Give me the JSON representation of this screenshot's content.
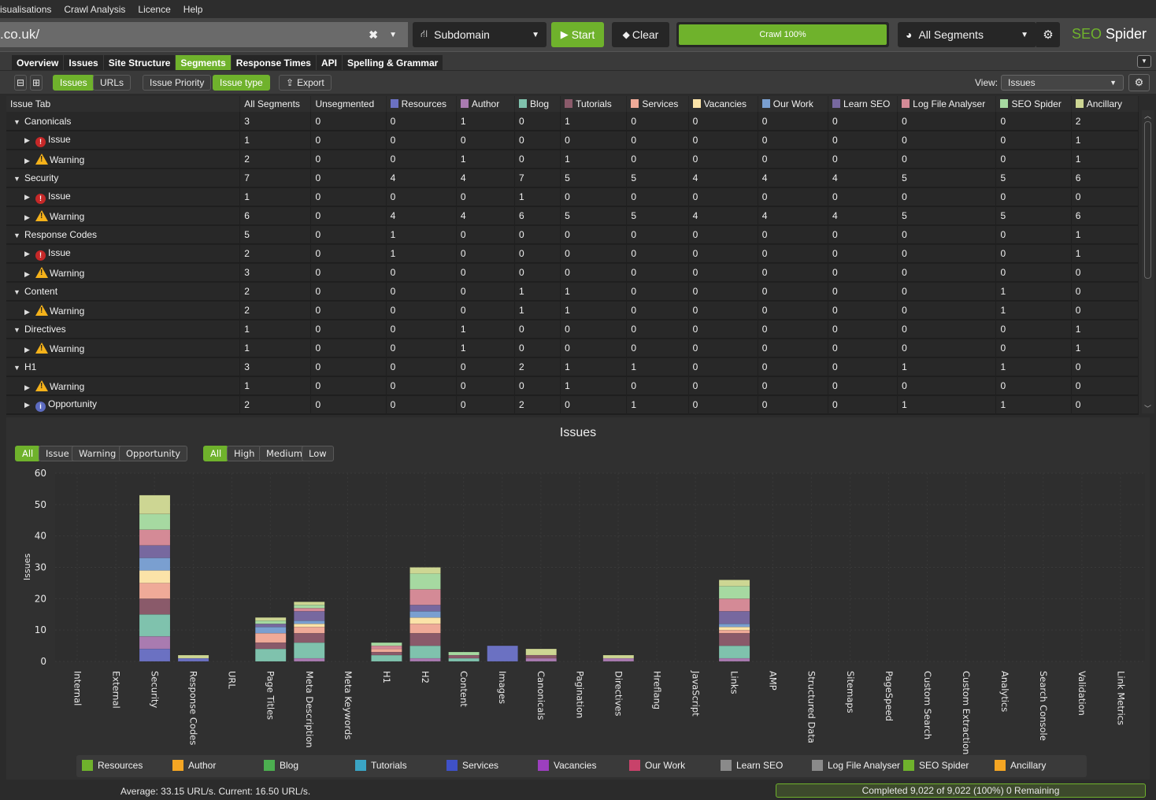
{
  "menu": [
    "isualisations",
    "Crawl Analysis",
    "Licence",
    "Help"
  ],
  "toolbar": {
    "url": ".co.uk/",
    "mode": "Subdomain",
    "start_label": "Start",
    "clear_label": "Clear",
    "crawl_progress_label": "Crawl 100%",
    "crawl_progress": 1.0,
    "segments_label": "All Segments",
    "brand_seo": "SEO",
    "brand_spider": " Spider"
  },
  "tabs": [
    {
      "label": "Overview",
      "active": false
    },
    {
      "label": "Issues",
      "active": false
    },
    {
      "label": "Site Structure",
      "active": false
    },
    {
      "label": "Segments",
      "active": true
    },
    {
      "label": "Response Times",
      "active": false
    },
    {
      "label": "API",
      "active": false
    },
    {
      "label": "Spelling & Grammar",
      "active": false
    }
  ],
  "subtoolbar": {
    "issues_label": "Issues",
    "urls_label": "URLs",
    "issue_priority_label": "Issue Priority",
    "issue_type_label": "Issue type",
    "export_label": "Export",
    "view_label": "View:",
    "view_value": "Issues"
  },
  "segments": [
    {
      "name": "Resources",
      "color": "#6b71c2"
    },
    {
      "name": "Author",
      "color": "#a97bb0"
    },
    {
      "name": "Blog",
      "color": "#7fc2ad"
    },
    {
      "name": "Tutorials",
      "color": "#8a5a6a"
    },
    {
      "name": "Services",
      "color": "#efaa98"
    },
    {
      "name": "Vacancies",
      "color": "#fbe3a8"
    },
    {
      "name": "Our Work",
      "color": "#7a9fd0"
    },
    {
      "name": "Learn SEO",
      "color": "#77689f"
    },
    {
      "name": "Log File Analyser",
      "color": "#d48a96"
    },
    {
      "name": "SEO Spider",
      "color": "#a6d9a1"
    },
    {
      "name": "Ancillary",
      "color": "#cdd693"
    }
  ],
  "table": {
    "headers": [
      "Issue Tab",
      "All Segments",
      "Unsegmented",
      "Resources",
      "Author",
      "Blog",
      "Tutorials",
      "Services",
      "Vacancies",
      "Our Work",
      "Learn SEO",
      "Log File Analyser",
      "SEO Spider",
      "Ancillary"
    ],
    "rows": [
      {
        "level": 0,
        "label": "Canonicals",
        "type": "group",
        "values": [
          3,
          0,
          0,
          1,
          0,
          1,
          0,
          0,
          0,
          0,
          0,
          0,
          2
        ]
      },
      {
        "level": 1,
        "label": "Issue",
        "type": "issue",
        "values": [
          1,
          0,
          0,
          0,
          0,
          0,
          0,
          0,
          0,
          0,
          0,
          0,
          1
        ]
      },
      {
        "level": 1,
        "label": "Warning",
        "type": "warning",
        "values": [
          2,
          0,
          0,
          1,
          0,
          1,
          0,
          0,
          0,
          0,
          0,
          0,
          1
        ]
      },
      {
        "level": 0,
        "label": "Security",
        "type": "group",
        "values": [
          7,
          0,
          4,
          4,
          7,
          5,
          5,
          4,
          4,
          4,
          5,
          5,
          6
        ]
      },
      {
        "level": 1,
        "label": "Issue",
        "type": "issue",
        "values": [
          1,
          0,
          0,
          0,
          1,
          0,
          0,
          0,
          0,
          0,
          0,
          0,
          0
        ]
      },
      {
        "level": 1,
        "label": "Warning",
        "type": "warning",
        "values": [
          6,
          0,
          4,
          4,
          6,
          5,
          5,
          4,
          4,
          4,
          5,
          5,
          6
        ]
      },
      {
        "level": 0,
        "label": "Response Codes",
        "type": "group",
        "values": [
          5,
          0,
          1,
          0,
          0,
          0,
          0,
          0,
          0,
          0,
          0,
          0,
          1
        ]
      },
      {
        "level": 1,
        "label": "Issue",
        "type": "issue",
        "values": [
          2,
          0,
          1,
          0,
          0,
          0,
          0,
          0,
          0,
          0,
          0,
          0,
          1
        ]
      },
      {
        "level": 1,
        "label": "Warning",
        "type": "warning",
        "values": [
          3,
          0,
          0,
          0,
          0,
          0,
          0,
          0,
          0,
          0,
          0,
          0,
          0
        ]
      },
      {
        "level": 0,
        "label": "Content",
        "type": "group",
        "values": [
          2,
          0,
          0,
          0,
          1,
          1,
          0,
          0,
          0,
          0,
          0,
          1,
          0
        ]
      },
      {
        "level": 1,
        "label": "Warning",
        "type": "warning",
        "values": [
          2,
          0,
          0,
          0,
          1,
          1,
          0,
          0,
          0,
          0,
          0,
          1,
          0
        ]
      },
      {
        "level": 0,
        "label": "Directives",
        "type": "group",
        "values": [
          1,
          0,
          0,
          1,
          0,
          0,
          0,
          0,
          0,
          0,
          0,
          0,
          1
        ]
      },
      {
        "level": 1,
        "label": "Warning",
        "type": "warning",
        "values": [
          1,
          0,
          0,
          1,
          0,
          0,
          0,
          0,
          0,
          0,
          0,
          0,
          1
        ]
      },
      {
        "level": 0,
        "label": "H1",
        "type": "group",
        "values": [
          3,
          0,
          0,
          0,
          2,
          1,
          1,
          0,
          0,
          0,
          1,
          1,
          0
        ]
      },
      {
        "level": 1,
        "label": "Warning",
        "type": "warning",
        "values": [
          1,
          0,
          0,
          0,
          0,
          1,
          0,
          0,
          0,
          0,
          0,
          0,
          0
        ]
      },
      {
        "level": 1,
        "label": "Opportunity",
        "type": "opportunity",
        "values": [
          2,
          0,
          0,
          0,
          2,
          0,
          1,
          0,
          0,
          0,
          1,
          1,
          0
        ]
      }
    ]
  },
  "chart_filters": {
    "type_buttons": [
      {
        "label": "All",
        "active": true
      },
      {
        "label": "Issue",
        "active": false
      },
      {
        "label": "Warning",
        "active": false
      },
      {
        "label": "Opportunity",
        "active": false
      }
    ],
    "priority_buttons": [
      {
        "label": "All",
        "active": true
      },
      {
        "label": "High",
        "active": false
      },
      {
        "label": "Medium",
        "active": false
      },
      {
        "label": "Low",
        "active": false
      }
    ]
  },
  "chart_data": {
    "type": "bar",
    "stacked": true,
    "title": "Issues",
    "xlabel": "",
    "ylabel": "Issues",
    "ylim": [
      0,
      60
    ],
    "yticks": [
      0,
      10,
      20,
      30,
      40,
      50,
      60
    ],
    "grid": true,
    "categories": [
      "Internal",
      "External",
      "Security",
      "Response Codes",
      "URL",
      "Page Titles",
      "Meta Description",
      "Meta Keywords",
      "H1",
      "H2",
      "Content",
      "Images",
      "Canonicals",
      "Pagination",
      "Directives",
      "Hreflang",
      "JavaScript",
      "Links",
      "AMP",
      "Structured Data",
      "Sitemaps",
      "PageSpeed",
      "Custom Search",
      "Custom Extraction",
      "Analytics",
      "Search Console",
      "Validation",
      "Link Metrics"
    ],
    "series": [
      {
        "name": "Resources",
        "values": [
          0,
          0,
          4,
          1,
          0,
          0,
          0,
          0,
          0,
          0,
          0,
          5,
          0,
          0,
          0,
          0,
          0,
          0,
          0,
          0,
          0,
          0,
          0,
          0,
          0,
          0,
          0,
          0
        ]
      },
      {
        "name": "Author",
        "values": [
          0,
          0,
          4,
          0,
          0,
          0,
          1,
          0,
          0,
          1,
          0,
          0,
          1,
          0,
          1,
          0,
          0,
          1,
          0,
          0,
          0,
          0,
          0,
          0,
          0,
          0,
          0,
          0
        ]
      },
      {
        "name": "Blog",
        "values": [
          0,
          0,
          7,
          0,
          0,
          4,
          5,
          0,
          2,
          4,
          1,
          0,
          0,
          0,
          0,
          0,
          0,
          4,
          0,
          0,
          0,
          0,
          0,
          0,
          0,
          0,
          0,
          0
        ]
      },
      {
        "name": "Tutorials",
        "values": [
          0,
          0,
          5,
          0,
          0,
          2,
          3,
          0,
          1,
          4,
          1,
          0,
          1,
          0,
          0,
          0,
          0,
          4,
          0,
          0,
          0,
          0,
          0,
          0,
          0,
          0,
          0,
          0
        ]
      },
      {
        "name": "Services",
        "values": [
          0,
          0,
          5,
          0,
          0,
          3,
          2,
          0,
          1,
          3,
          0,
          0,
          0,
          0,
          0,
          0,
          0,
          1,
          0,
          0,
          0,
          0,
          0,
          0,
          0,
          0,
          0,
          0
        ]
      },
      {
        "name": "Vacancies",
        "values": [
          0,
          0,
          4,
          0,
          0,
          0,
          1,
          0,
          0,
          2,
          0,
          0,
          0,
          0,
          0,
          0,
          0,
          1,
          0,
          0,
          0,
          0,
          0,
          0,
          0,
          0,
          0,
          0
        ]
      },
      {
        "name": "Our Work",
        "values": [
          0,
          0,
          4,
          0,
          0,
          2,
          1,
          0,
          0,
          2,
          0,
          0,
          0,
          0,
          0,
          0,
          0,
          1,
          0,
          0,
          0,
          0,
          0,
          0,
          0,
          0,
          0,
          0
        ]
      },
      {
        "name": "Learn SEO",
        "values": [
          0,
          0,
          4,
          0,
          0,
          1,
          3,
          0,
          0,
          2,
          0,
          0,
          0,
          0,
          0,
          0,
          0,
          4,
          0,
          0,
          0,
          0,
          0,
          0,
          0,
          0,
          0,
          0
        ]
      },
      {
        "name": "Log File Analyser",
        "values": [
          0,
          0,
          5,
          0,
          0,
          0,
          1,
          0,
          1,
          5,
          0,
          0,
          0,
          0,
          0,
          0,
          0,
          4,
          0,
          0,
          0,
          0,
          0,
          0,
          0,
          0,
          0,
          0
        ]
      },
      {
        "name": "SEO Spider",
        "values": [
          0,
          0,
          5,
          0,
          0,
          1,
          1,
          0,
          1,
          5,
          1,
          0,
          0,
          0,
          0,
          0,
          0,
          4,
          0,
          0,
          0,
          0,
          0,
          0,
          0,
          0,
          0,
          0
        ]
      },
      {
        "name": "Ancillary",
        "values": [
          0,
          0,
          6,
          1,
          0,
          1,
          1,
          0,
          0,
          2,
          0,
          0,
          2,
          0,
          1,
          0,
          0,
          2,
          0,
          0,
          0,
          0,
          0,
          0,
          0,
          0,
          0,
          0
        ]
      }
    ]
  },
  "legend": [
    {
      "name": "Resources",
      "color": "#6fb22c"
    },
    {
      "name": "Author",
      "color": "#f5a623"
    },
    {
      "name": "Blog",
      "color": "#4caf50"
    },
    {
      "name": "Tutorials",
      "color": "#3aa4c4"
    },
    {
      "name": "Services",
      "color": "#3f51c8"
    },
    {
      "name": "Vacancies",
      "color": "#9c3fbf"
    },
    {
      "name": "Our Work",
      "color": "#c8426a"
    },
    {
      "name": "Learn SEO",
      "color": "#8a8a8a"
    },
    {
      "name": "Log File Analyser",
      "color": "#8a8a8a"
    },
    {
      "name": "SEO Spider",
      "color": "#6fb22c"
    },
    {
      "name": "Ancillary",
      "color": "#f5a623"
    }
  ],
  "status": {
    "speed": "Average: 33.15 URL/s. Current: 16.50 URL/s.",
    "progress_label": "Completed 9,022 of 9,022 (100%) 0 Remaining",
    "progress": 1.0
  }
}
